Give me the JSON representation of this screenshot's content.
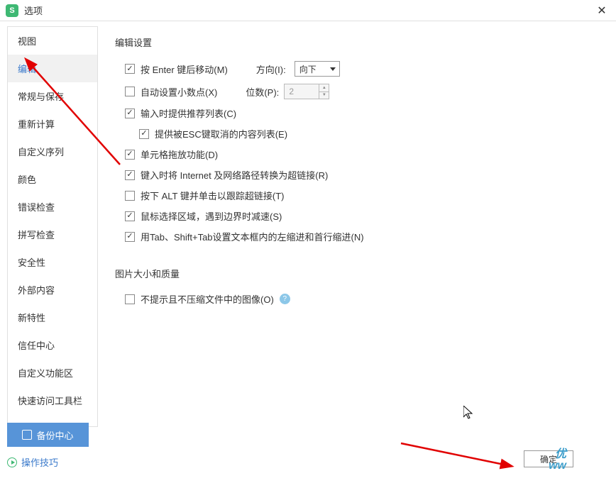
{
  "title": "选项",
  "sidebar": {
    "items": [
      {
        "label": "视图"
      },
      {
        "label": "编辑"
      },
      {
        "label": "常规与保存"
      },
      {
        "label": "重新计算"
      },
      {
        "label": "自定义序列"
      },
      {
        "label": "颜色"
      },
      {
        "label": "错误检查"
      },
      {
        "label": "拼写检查"
      },
      {
        "label": "安全性"
      },
      {
        "label": "外部内容"
      },
      {
        "label": "新特性"
      },
      {
        "label": "信任中心"
      },
      {
        "label": "自定义功能区"
      },
      {
        "label": "快速访问工具栏"
      }
    ],
    "activeIndex": 1
  },
  "edit": {
    "section_title": "编辑设置",
    "enter_move": {
      "checked": true,
      "label": "按 Enter 键后移动(M)"
    },
    "direction_label": "方向(I):",
    "direction_value": "向下",
    "auto_decimal": {
      "checked": false,
      "label": "自动设置小数点(X)"
    },
    "places_label": "位数(P):",
    "places_value": "2",
    "suggest_list": {
      "checked": true,
      "label": "输入时提供推荐列表(C)"
    },
    "esc_suggest": {
      "checked": true,
      "label": "提供被ESC键取消的内容列表(E)"
    },
    "drag_fill": {
      "checked": true,
      "label": "单元格拖放功能(D)"
    },
    "internet_link": {
      "checked": true,
      "label": "键入时将 Internet 及网络路径转换为超链接(R)"
    },
    "alt_click": {
      "checked": false,
      "label": "按下 ALT 键并单击以跟踪超链接(T)"
    },
    "mouse_select": {
      "checked": true,
      "label": "鼠标选择区域，遇到边界时减速(S)"
    },
    "tab_indent": {
      "checked": true,
      "label": "用Tab、Shift+Tab设置文本框内的左缩进和首行缩进(N)"
    }
  },
  "image": {
    "section_title": "图片大小和质量",
    "no_compress": {
      "checked": false,
      "label": "不提示且不压缩文件中的图像(O)"
    }
  },
  "footer": {
    "backup_label": "备份中心",
    "tips_label": "操作技巧",
    "ok_label": "确定"
  },
  "watermark": {
    "top": "优",
    "bottom": "ww"
  }
}
